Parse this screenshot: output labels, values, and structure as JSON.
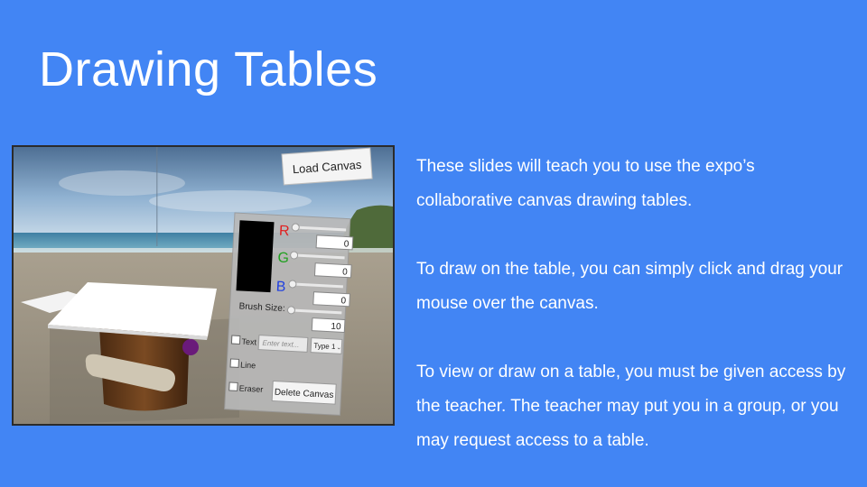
{
  "slide": {
    "title": "Drawing Tables",
    "paragraphs": [
      "These slides will teach you to use the expo’s collaborative canvas drawing tables.",
      "To draw on the table, you can simply click and drag your mouse over the canvas.",
      "To view or draw on a table, you must be given access by the teacher. The teacher may put you in a group, or you may request access to a table."
    ]
  },
  "screenshot_ui": {
    "load_canvas_label": "Load Canvas",
    "r_label": "R",
    "g_label": "G",
    "b_label": "B",
    "r_value": "0",
    "g_value": "0",
    "b_value": "0",
    "brush_size_label": "Brush Size:",
    "brush_size_value": "10",
    "text_option_label": "Text",
    "text_input_placeholder": "Enter text...",
    "type_select_value": "Type 1",
    "line_option_label": "Line",
    "eraser_option_label": "Eraser",
    "delete_canvas_label": "Delete Canvas",
    "colors": {
      "r": "#e02020",
      "g": "#1fa01f",
      "b": "#1f3fe0",
      "background": "#4285f4"
    }
  }
}
